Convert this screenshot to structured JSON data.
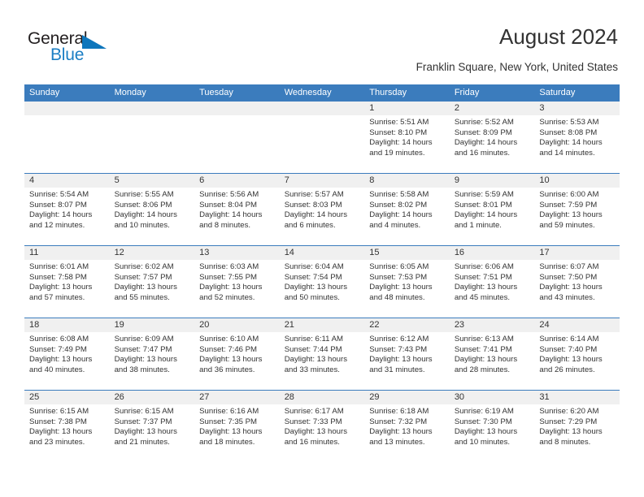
{
  "brand": {
    "name_part1": "General",
    "name_part2": "Blue",
    "color_primary": "#1b7ec4",
    "color_dark": "#231f20"
  },
  "header": {
    "title": "August 2024",
    "subtitle": "Franklin Square, New York, United States",
    "accent_color": "#3b7cbd",
    "band_color": "#f0f0f0"
  },
  "weekdays": [
    "Sunday",
    "Monday",
    "Tuesday",
    "Wednesday",
    "Thursday",
    "Friday",
    "Saturday"
  ],
  "labels": {
    "sunrise_prefix": "Sunrise:",
    "sunset_prefix": "Sunset:",
    "daylight_prefix": "Daylight:"
  },
  "weeks": [
    [
      {
        "date": "",
        "lines": []
      },
      {
        "date": "",
        "lines": []
      },
      {
        "date": "",
        "lines": []
      },
      {
        "date": "",
        "lines": []
      },
      {
        "date": "1",
        "sunrise": "5:51 AM",
        "sunset": "8:10 PM",
        "daylight": "14 hours and 19 minutes.",
        "lines": [
          "Sunrise: 5:51 AM",
          "Sunset: 8:10 PM",
          "Daylight: 14 hours",
          "and 19 minutes."
        ]
      },
      {
        "date": "2",
        "sunrise": "5:52 AM",
        "sunset": "8:09 PM",
        "daylight": "14 hours and 16 minutes.",
        "lines": [
          "Sunrise: 5:52 AM",
          "Sunset: 8:09 PM",
          "Daylight: 14 hours",
          "and 16 minutes."
        ]
      },
      {
        "date": "3",
        "sunrise": "5:53 AM",
        "sunset": "8:08 PM",
        "daylight": "14 hours and 14 minutes.",
        "lines": [
          "Sunrise: 5:53 AM",
          "Sunset: 8:08 PM",
          "Daylight: 14 hours",
          "and 14 minutes."
        ]
      }
    ],
    [
      {
        "date": "4",
        "sunrise": "5:54 AM",
        "sunset": "8:07 PM",
        "daylight": "14 hours and 12 minutes.",
        "lines": [
          "Sunrise: 5:54 AM",
          "Sunset: 8:07 PM",
          "Daylight: 14 hours",
          "and 12 minutes."
        ]
      },
      {
        "date": "5",
        "sunrise": "5:55 AM",
        "sunset": "8:06 PM",
        "daylight": "14 hours and 10 minutes.",
        "lines": [
          "Sunrise: 5:55 AM",
          "Sunset: 8:06 PM",
          "Daylight: 14 hours",
          "and 10 minutes."
        ]
      },
      {
        "date": "6",
        "sunrise": "5:56 AM",
        "sunset": "8:04 PM",
        "daylight": "14 hours and 8 minutes.",
        "lines": [
          "Sunrise: 5:56 AM",
          "Sunset: 8:04 PM",
          "Daylight: 14 hours",
          "and 8 minutes."
        ]
      },
      {
        "date": "7",
        "sunrise": "5:57 AM",
        "sunset": "8:03 PM",
        "daylight": "14 hours and 6 minutes.",
        "lines": [
          "Sunrise: 5:57 AM",
          "Sunset: 8:03 PM",
          "Daylight: 14 hours",
          "and 6 minutes."
        ]
      },
      {
        "date": "8",
        "sunrise": "5:58 AM",
        "sunset": "8:02 PM",
        "daylight": "14 hours and 4 minutes.",
        "lines": [
          "Sunrise: 5:58 AM",
          "Sunset: 8:02 PM",
          "Daylight: 14 hours",
          "and 4 minutes."
        ]
      },
      {
        "date": "9",
        "sunrise": "5:59 AM",
        "sunset": "8:01 PM",
        "daylight": "14 hours and 1 minute.",
        "lines": [
          "Sunrise: 5:59 AM",
          "Sunset: 8:01 PM",
          "Daylight: 14 hours",
          "and 1 minute."
        ]
      },
      {
        "date": "10",
        "sunrise": "6:00 AM",
        "sunset": "7:59 PM",
        "daylight": "13 hours and 59 minutes.",
        "lines": [
          "Sunrise: 6:00 AM",
          "Sunset: 7:59 PM",
          "Daylight: 13 hours",
          "and 59 minutes."
        ]
      }
    ],
    [
      {
        "date": "11",
        "sunrise": "6:01 AM",
        "sunset": "7:58 PM",
        "daylight": "13 hours and 57 minutes.",
        "lines": [
          "Sunrise: 6:01 AM",
          "Sunset: 7:58 PM",
          "Daylight: 13 hours",
          "and 57 minutes."
        ]
      },
      {
        "date": "12",
        "sunrise": "6:02 AM",
        "sunset": "7:57 PM",
        "daylight": "13 hours and 55 minutes.",
        "lines": [
          "Sunrise: 6:02 AM",
          "Sunset: 7:57 PM",
          "Daylight: 13 hours",
          "and 55 minutes."
        ]
      },
      {
        "date": "13",
        "sunrise": "6:03 AM",
        "sunset": "7:55 PM",
        "daylight": "13 hours and 52 minutes.",
        "lines": [
          "Sunrise: 6:03 AM",
          "Sunset: 7:55 PM",
          "Daylight: 13 hours",
          "and 52 minutes."
        ]
      },
      {
        "date": "14",
        "sunrise": "6:04 AM",
        "sunset": "7:54 PM",
        "daylight": "13 hours and 50 minutes.",
        "lines": [
          "Sunrise: 6:04 AM",
          "Sunset: 7:54 PM",
          "Daylight: 13 hours",
          "and 50 minutes."
        ]
      },
      {
        "date": "15",
        "sunrise": "6:05 AM",
        "sunset": "7:53 PM",
        "daylight": "13 hours and 48 minutes.",
        "lines": [
          "Sunrise: 6:05 AM",
          "Sunset: 7:53 PM",
          "Daylight: 13 hours",
          "and 48 minutes."
        ]
      },
      {
        "date": "16",
        "sunrise": "6:06 AM",
        "sunset": "7:51 PM",
        "daylight": "13 hours and 45 minutes.",
        "lines": [
          "Sunrise: 6:06 AM",
          "Sunset: 7:51 PM",
          "Daylight: 13 hours",
          "and 45 minutes."
        ]
      },
      {
        "date": "17",
        "sunrise": "6:07 AM",
        "sunset": "7:50 PM",
        "daylight": "13 hours and 43 minutes.",
        "lines": [
          "Sunrise: 6:07 AM",
          "Sunset: 7:50 PM",
          "Daylight: 13 hours",
          "and 43 minutes."
        ]
      }
    ],
    [
      {
        "date": "18",
        "sunrise": "6:08 AM",
        "sunset": "7:49 PM",
        "daylight": "13 hours and 40 minutes.",
        "lines": [
          "Sunrise: 6:08 AM",
          "Sunset: 7:49 PM",
          "Daylight: 13 hours",
          "and 40 minutes."
        ]
      },
      {
        "date": "19",
        "sunrise": "6:09 AM",
        "sunset": "7:47 PM",
        "daylight": "13 hours and 38 minutes.",
        "lines": [
          "Sunrise: 6:09 AM",
          "Sunset: 7:47 PM",
          "Daylight: 13 hours",
          "and 38 minutes."
        ]
      },
      {
        "date": "20",
        "sunrise": "6:10 AM",
        "sunset": "7:46 PM",
        "daylight": "13 hours and 36 minutes.",
        "lines": [
          "Sunrise: 6:10 AM",
          "Sunset: 7:46 PM",
          "Daylight: 13 hours",
          "and 36 minutes."
        ]
      },
      {
        "date": "21",
        "sunrise": "6:11 AM",
        "sunset": "7:44 PM",
        "daylight": "13 hours and 33 minutes.",
        "lines": [
          "Sunrise: 6:11 AM",
          "Sunset: 7:44 PM",
          "Daylight: 13 hours",
          "and 33 minutes."
        ]
      },
      {
        "date": "22",
        "sunrise": "6:12 AM",
        "sunset": "7:43 PM",
        "daylight": "13 hours and 31 minutes.",
        "lines": [
          "Sunrise: 6:12 AM",
          "Sunset: 7:43 PM",
          "Daylight: 13 hours",
          "and 31 minutes."
        ]
      },
      {
        "date": "23",
        "sunrise": "6:13 AM",
        "sunset": "7:41 PM",
        "daylight": "13 hours and 28 minutes.",
        "lines": [
          "Sunrise: 6:13 AM",
          "Sunset: 7:41 PM",
          "Daylight: 13 hours",
          "and 28 minutes."
        ]
      },
      {
        "date": "24",
        "sunrise": "6:14 AM",
        "sunset": "7:40 PM",
        "daylight": "13 hours and 26 minutes.",
        "lines": [
          "Sunrise: 6:14 AM",
          "Sunset: 7:40 PM",
          "Daylight: 13 hours",
          "and 26 minutes."
        ]
      }
    ],
    [
      {
        "date": "25",
        "sunrise": "6:15 AM",
        "sunset": "7:38 PM",
        "daylight": "13 hours and 23 minutes.",
        "lines": [
          "Sunrise: 6:15 AM",
          "Sunset: 7:38 PM",
          "Daylight: 13 hours",
          "and 23 minutes."
        ]
      },
      {
        "date": "26",
        "sunrise": "6:15 AM",
        "sunset": "7:37 PM",
        "daylight": "13 hours and 21 minutes.",
        "lines": [
          "Sunrise: 6:15 AM",
          "Sunset: 7:37 PM",
          "Daylight: 13 hours",
          "and 21 minutes."
        ]
      },
      {
        "date": "27",
        "sunrise": "6:16 AM",
        "sunset": "7:35 PM",
        "daylight": "13 hours and 18 minutes.",
        "lines": [
          "Sunrise: 6:16 AM",
          "Sunset: 7:35 PM",
          "Daylight: 13 hours",
          "and 18 minutes."
        ]
      },
      {
        "date": "28",
        "sunrise": "6:17 AM",
        "sunset": "7:33 PM",
        "daylight": "13 hours and 16 minutes.",
        "lines": [
          "Sunrise: 6:17 AM",
          "Sunset: 7:33 PM",
          "Daylight: 13 hours",
          "and 16 minutes."
        ]
      },
      {
        "date": "29",
        "sunrise": "6:18 AM",
        "sunset": "7:32 PM",
        "daylight": "13 hours and 13 minutes.",
        "lines": [
          "Sunrise: 6:18 AM",
          "Sunset: 7:32 PM",
          "Daylight: 13 hours",
          "and 13 minutes."
        ]
      },
      {
        "date": "30",
        "sunrise": "6:19 AM",
        "sunset": "7:30 PM",
        "daylight": "13 hours and 10 minutes.",
        "lines": [
          "Sunrise: 6:19 AM",
          "Sunset: 7:30 PM",
          "Daylight: 13 hours",
          "and 10 minutes."
        ]
      },
      {
        "date": "31",
        "sunrise": "6:20 AM",
        "sunset": "7:29 PM",
        "daylight": "13 hours and 8 minutes.",
        "lines": [
          "Sunrise: 6:20 AM",
          "Sunset: 7:29 PM",
          "Daylight: 13 hours",
          "and 8 minutes."
        ]
      }
    ]
  ]
}
